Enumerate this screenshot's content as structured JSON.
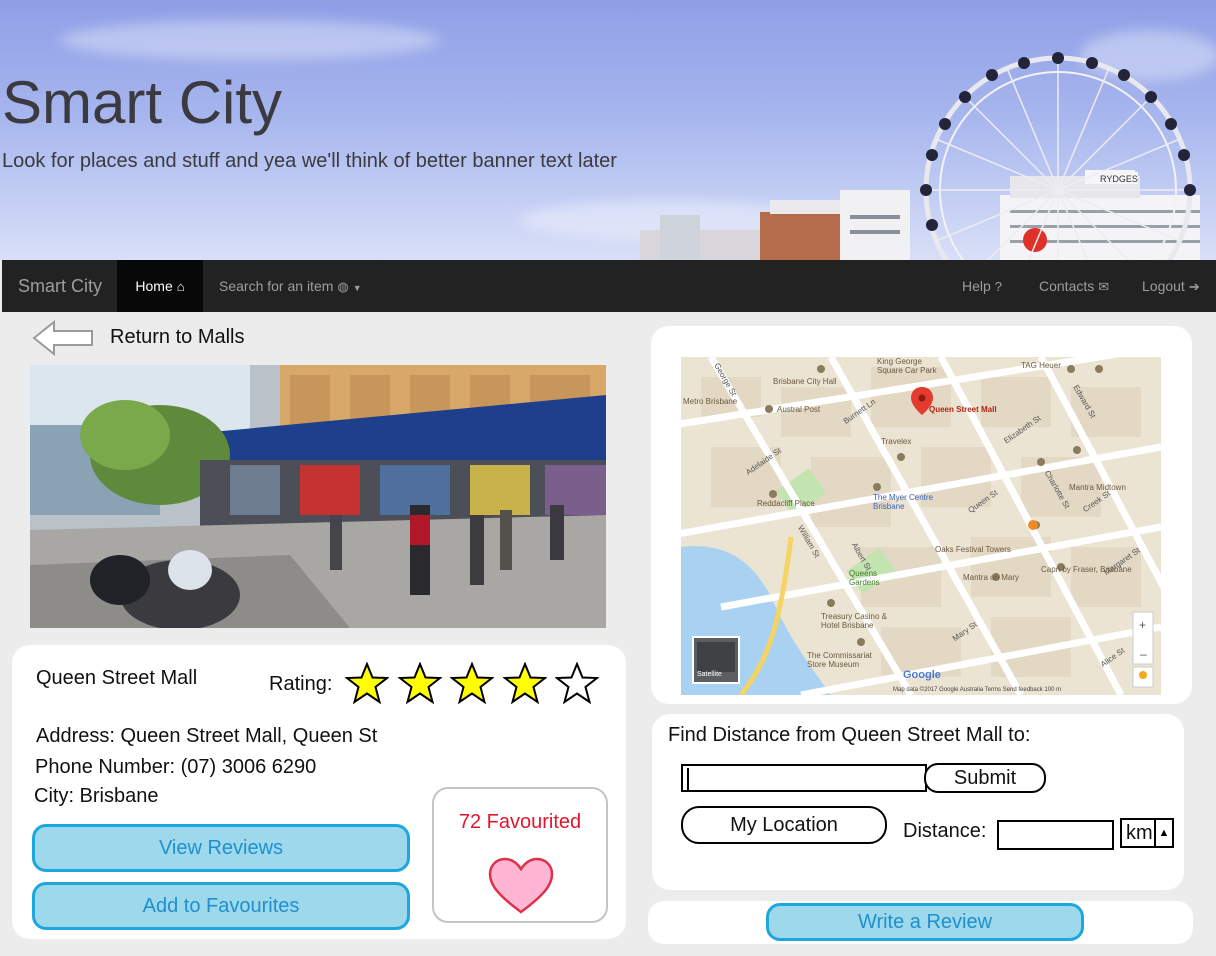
{
  "banner": {
    "title": "Smart City",
    "subtitle": "Look for places and stuff and yea we'll think of better banner text later"
  },
  "navbar": {
    "brand": "Smart City",
    "home": "Home",
    "search": "Search for an item",
    "help": "Help",
    "contacts": "Contacts",
    "logout": "Logout"
  },
  "back": {
    "label": "Return to Malls"
  },
  "place": {
    "name": "Queen Street Mall",
    "rating_label": "Rating:",
    "rating": 4,
    "rating_max": 5,
    "address": "Address: Queen Street Mall, Queen St",
    "phone": "Phone Number: (07) 3006 6290",
    "city": "City: Brisbane"
  },
  "buttons": {
    "view_reviews": "View Reviews",
    "add_favourites": "Add to Favourites",
    "write_review": "Write a Review"
  },
  "favourites": {
    "count_text": "72 Favourited"
  },
  "map": {
    "streets": [
      "George St",
      "Albert St",
      "Edward St",
      "Elizabeth St",
      "Charlotte St",
      "Mary St",
      "Margaret St",
      "Adelaide St",
      "Queen St",
      "Burnett Ln",
      "William St",
      "Creek St",
      "Alice St"
    ],
    "pois": [
      "Queen Street Mall",
      "Brisbane City Hall",
      "Austral Post",
      "Metro Brisbane",
      "Travelex",
      "The Myer Centre Brisbane",
      "Reddacliff Place",
      "Oaks Festival Towers",
      "Mantra on Mary",
      "Capri by Fraser, Brisbane",
      "Treasury Casino & Hotel Brisbane",
      "The Commissariat Store Museum",
      "Queens Gardens",
      "Mantra Midtown",
      "TAG Heuer",
      "King George Square Car Park"
    ],
    "marker_label": "Queen Street Mall",
    "satellite_label": "Satellite",
    "google_label": "Google",
    "footer": "Map data ©2017 Google   Australia   Terms   Send feedback   100 m"
  },
  "distance": {
    "title": "Find Distance from Queen Street Mall to:",
    "input_value": "",
    "submit": "Submit",
    "my_location": "My Location",
    "distance_label": "Distance:",
    "distance_value": "",
    "unit": "km"
  },
  "colors": {
    "navbar_bg": "#222222",
    "button_fill": "#9dd9ea",
    "button_border": "#1ea7df",
    "button_text": "#1f8fd0",
    "favourite_text": "#e1162d",
    "star_fill": "#ffff00",
    "heart_fill": "#ffb6d5"
  }
}
